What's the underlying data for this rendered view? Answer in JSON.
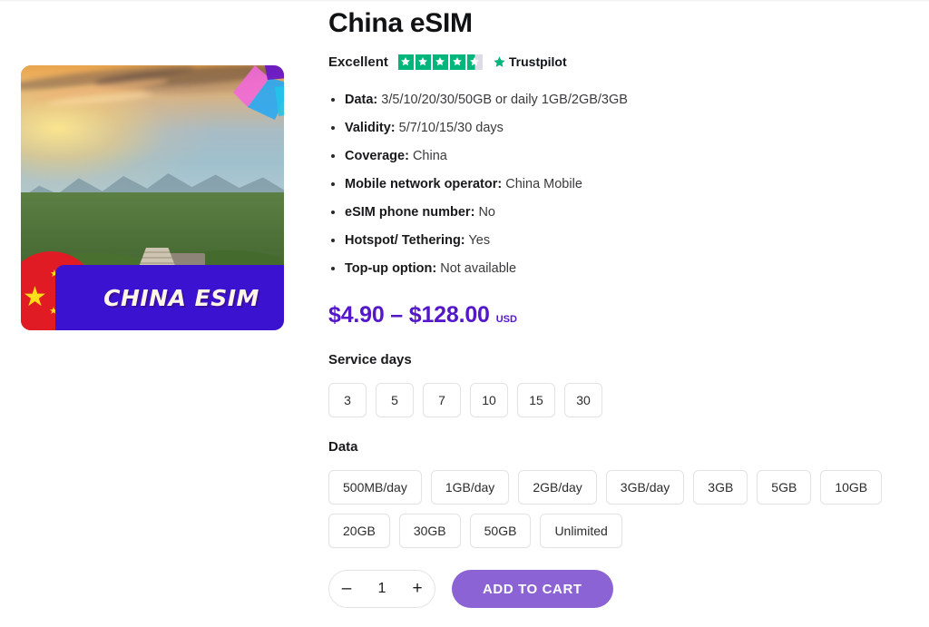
{
  "product": {
    "title": "China eSIM",
    "image": {
      "banner_text": "CHINA ESIM",
      "flag_name": "china-flag-badge",
      "scene_name": "great-wall-of-china-photo",
      "logo_name": "brand-fan-logo"
    }
  },
  "trustpilot": {
    "label": "Excellent",
    "brand": "Trustpilot",
    "rating": 4.5,
    "stars_total": 5,
    "star_color": "#00b67a",
    "star_empty_color": "#dcdce6"
  },
  "specs": [
    {
      "key": "Data:",
      "value": "3/5/10/20/30/50GB or daily 1GB/2GB/3GB"
    },
    {
      "key": "Validity:",
      "value": "5/7/10/15/30 days"
    },
    {
      "key": "Coverage:",
      "value": "China"
    },
    {
      "key": "Mobile network operator:",
      "value": "China Mobile"
    },
    {
      "key": "eSIM phone number:",
      "value": "No"
    },
    {
      "key": "Hotspot/ Tethering:",
      "value": "Yes"
    },
    {
      "key": "Top-up option:",
      "value": "Not available"
    }
  ],
  "price": {
    "range": "$4.90 – $128.00",
    "currency": "USD",
    "color": "#5417c9"
  },
  "options": {
    "service_days": {
      "label": "Service days",
      "values": [
        "3",
        "5",
        "7",
        "10",
        "15",
        "30"
      ]
    },
    "data": {
      "label": "Data",
      "values": [
        "500MB/day",
        "1GB/day",
        "2GB/day",
        "3GB/day",
        "3GB",
        "5GB",
        "10GB",
        "20GB",
        "30GB",
        "50GB",
        "Unlimited"
      ]
    }
  },
  "cart": {
    "decrease_label": "–",
    "increase_label": "+",
    "quantity": "1",
    "add_to_cart_label": "ADD TO CART",
    "button_color": "#8b63d4"
  }
}
